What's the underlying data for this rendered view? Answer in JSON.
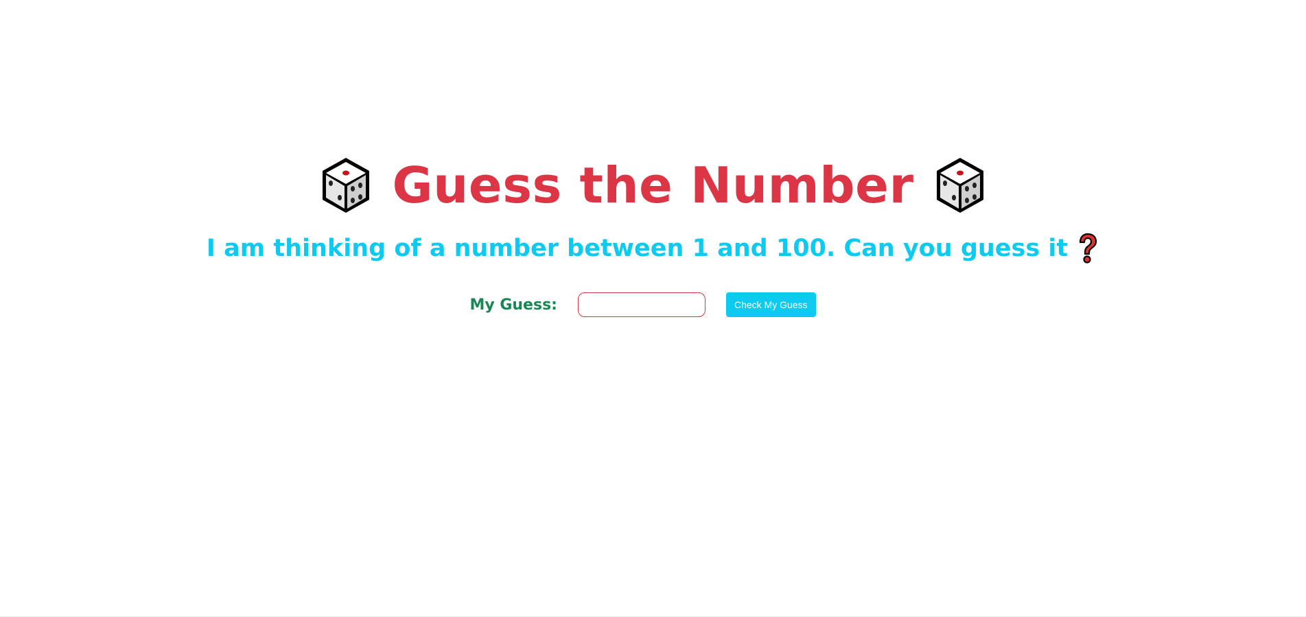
{
  "header": {
    "title": "Guess the Number",
    "left_icon": "dice-icon",
    "right_icon": "dice-icon"
  },
  "prompt": {
    "text": "I am thinking of a number between 1 and 100. Can you guess it",
    "icon": "question-mark-icon"
  },
  "form": {
    "label": "My Guess:",
    "input_value": "",
    "input_placeholder": "",
    "button_label": "Check My Guess"
  },
  "colors": {
    "title": "#dc3545",
    "prompt": "#0dcaf0",
    "label": "#198754",
    "input_border": "#dc3545",
    "button_bg": "#0dcaf0",
    "button_text": "#ffffff"
  }
}
